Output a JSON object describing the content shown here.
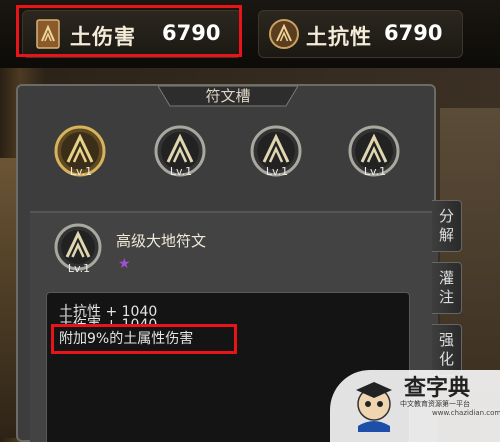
{
  "top_stats": {
    "earth_damage": {
      "label": "土伤害",
      "value": "6790"
    },
    "earth_resist": {
      "label": "土抗性",
      "value": "6790"
    }
  },
  "panel": {
    "title": "符文槽",
    "slots": [
      {
        "level": "Lv.1"
      },
      {
        "level": "Lv.1"
      },
      {
        "level": "Lv.1"
      },
      {
        "level": "Lv.1"
      }
    ]
  },
  "detail": {
    "rune_name": "高级大地符文",
    "rune_level": "Lv.1",
    "star": "★",
    "lines": [
      "土抗性 + 1040",
      "土伤害 + 1040",
      "附加9%的土属性伤害"
    ]
  },
  "tabs": {
    "split": "分解",
    "infuse": "灌注",
    "enhance": "强化"
  },
  "watermark": {
    "name": "查字典",
    "subtitle": "中文教育资源第一平台",
    "url": "www.chazidian.com"
  },
  "colors": {
    "highlight": "#e8141a",
    "rune_gold": "#c9b26a",
    "star_purple": "#a14fd6"
  }
}
